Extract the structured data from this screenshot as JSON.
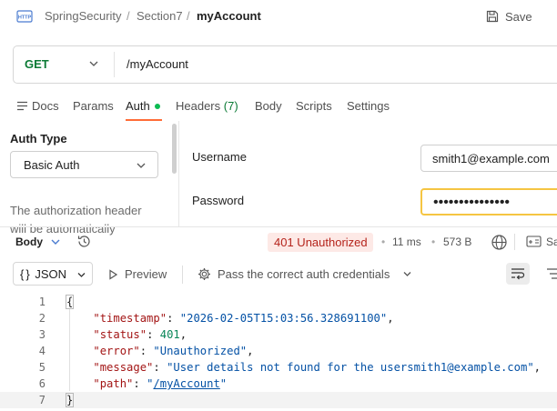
{
  "header": {
    "breadcrumb": [
      "SpringSecurity",
      "Section7",
      "myAccount"
    ],
    "separator": "/",
    "save_label": "Save"
  },
  "request": {
    "method": "GET",
    "url": "/myAccount"
  },
  "tabs": [
    {
      "label": "Docs"
    },
    {
      "label": "Params"
    },
    {
      "label": "Auth",
      "active": true
    },
    {
      "label": "Headers",
      "count": "(7)"
    },
    {
      "label": "Body"
    },
    {
      "label": "Scripts"
    },
    {
      "label": "Settings"
    }
  ],
  "auth": {
    "type_label": "Auth Type",
    "type_value": "Basic Auth",
    "description": [
      "The authorization header",
      "will be automatically"
    ],
    "username_label": "Username",
    "username_value": "smith1@example.com",
    "password_label": "Password",
    "password_value": "•••••••••••••••"
  },
  "response": {
    "body_label": "Body",
    "status": "401 Unauthorized",
    "time": "11 ms",
    "size": "573 B",
    "save_label": "Sa",
    "status_color": "#b5231b",
    "format": "JSON",
    "preview_label": "Preview",
    "hint_label": "Pass the correct auth credentials",
    "code": [
      {
        "no": "1",
        "parts": [
          {
            "t": "{",
            "c": ""
          }
        ]
      },
      {
        "no": "2",
        "parts": [
          {
            "t": "    ",
            "c": ""
          },
          {
            "t": "\"timestamp\"",
            "c": "k"
          },
          {
            "t": ": ",
            "c": ""
          },
          {
            "t": "\"2026-02-05T15:03:56.328691100\"",
            "c": "s"
          },
          {
            "t": ",",
            "c": ""
          }
        ]
      },
      {
        "no": "3",
        "parts": [
          {
            "t": "    ",
            "c": ""
          },
          {
            "t": "\"status\"",
            "c": "k"
          },
          {
            "t": ": ",
            "c": ""
          },
          {
            "t": "401",
            "c": "n"
          },
          {
            "t": ",",
            "c": ""
          }
        ]
      },
      {
        "no": "4",
        "parts": [
          {
            "t": "    ",
            "c": ""
          },
          {
            "t": "\"error\"",
            "c": "k"
          },
          {
            "t": ": ",
            "c": ""
          },
          {
            "t": "\"Unauthorized\"",
            "c": "s"
          },
          {
            "t": ",",
            "c": ""
          }
        ]
      },
      {
        "no": "5",
        "parts": [
          {
            "t": "    ",
            "c": ""
          },
          {
            "t": "\"message\"",
            "c": "k"
          },
          {
            "t": ": ",
            "c": ""
          },
          {
            "t": "\"User details not found for the usersmith1@example.com\"",
            "c": "s"
          },
          {
            "t": ",",
            "c": ""
          }
        ]
      },
      {
        "no": "6",
        "parts": [
          {
            "t": "    ",
            "c": ""
          },
          {
            "t": "\"path\"",
            "c": "k"
          },
          {
            "t": ": ",
            "c": ""
          },
          {
            "t": "\"",
            "c": "s"
          },
          {
            "t": "/myAccount",
            "c": "u"
          },
          {
            "t": "\"",
            "c": "s"
          }
        ]
      },
      {
        "no": "7",
        "parts": [
          {
            "t": "}",
            "c": ""
          }
        ]
      }
    ]
  }
}
